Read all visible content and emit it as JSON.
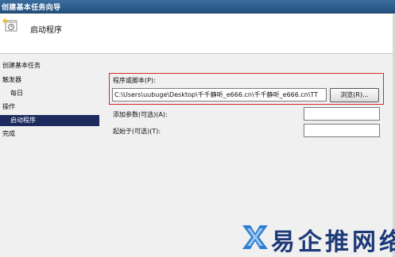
{
  "window": {
    "title": "创建基本任务向导"
  },
  "header": {
    "heading": "启动程序"
  },
  "sidebar": {
    "items": [
      {
        "label": "创建基本任务"
      },
      {
        "label": "触发器"
      },
      {
        "label": "每日"
      },
      {
        "label": "操作"
      },
      {
        "label": "启动程序"
      },
      {
        "label": "完成"
      }
    ]
  },
  "form": {
    "program_label": "程序或脚本(P):",
    "program_value": "C:\\Users\\uubuge\\Desktop\\千千静听_e666.cn\\千千静听_e666.cn\\TT",
    "browse_label": "浏览(R)...",
    "args_label": "添加参数(可选)(A):",
    "args_value": "",
    "startin_label": "起始于(可选)(T):",
    "startin_value": ""
  },
  "watermark": {
    "text": "易企推网络",
    "icon": "blue-x-logo-icon"
  },
  "colors": {
    "titlebar": "#2d5f8f",
    "active_item": "#1c2a5e",
    "highlight_border": "#d9262a",
    "watermark": "#1d3a78"
  }
}
